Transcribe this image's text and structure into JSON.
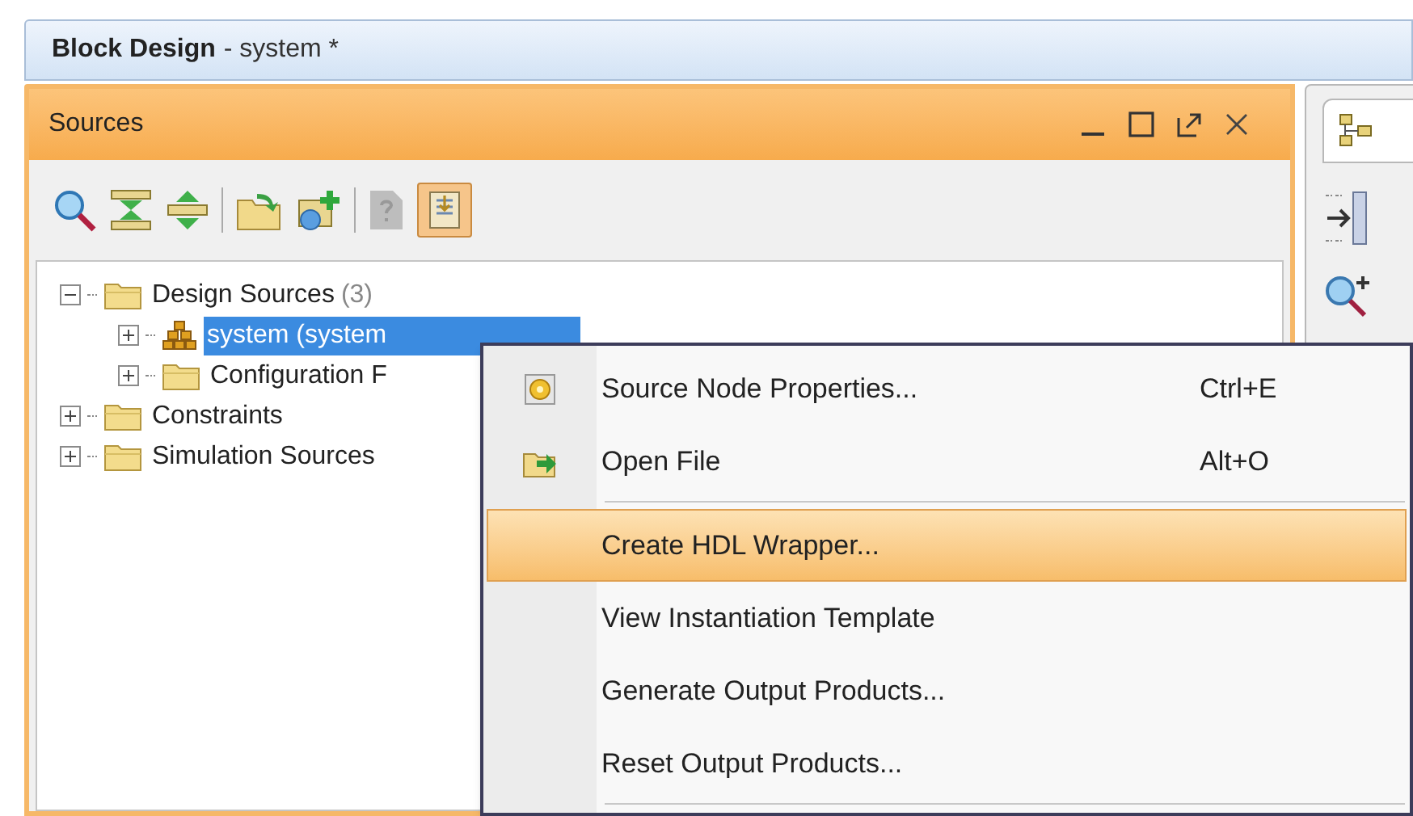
{
  "window": {
    "title": "Block Design",
    "subtitle": "- system *"
  },
  "sources_panel": {
    "title": "Sources",
    "active": true
  },
  "toolbar": {
    "toggle_pressed": true
  },
  "tree": [
    {
      "label": "Design Sources",
      "count": "(3)",
      "kind": "folder",
      "expanded": true,
      "selected": false,
      "children": [
        {
          "label": "system (system",
          "kind": "block",
          "expanded": false,
          "selected": true
        },
        {
          "label": "Configuration F",
          "kind": "folder",
          "expanded": false,
          "selected": false
        }
      ]
    },
    {
      "label": "Constraints",
      "kind": "folder",
      "expanded": false,
      "selected": false
    },
    {
      "label": "Simulation Sources",
      "kind": "folder",
      "expanded": false,
      "selected": false
    }
  ],
  "context_menu": [
    {
      "label": "Source Node Properties...",
      "shortcut": "Ctrl+E",
      "kind": "properties",
      "selected": false,
      "separator_after": false
    },
    {
      "label": "Open File",
      "shortcut": "Alt+O",
      "kind": "open",
      "selected": false,
      "separator_after": true
    },
    {
      "label": "Create HDL Wrapper...",
      "kind": "plain",
      "selected": true,
      "separator_after": false
    },
    {
      "label": "View Instantiation Template",
      "kind": "plain",
      "selected": false,
      "separator_after": false
    },
    {
      "label": "Generate Output Products...",
      "kind": "plain",
      "selected": false,
      "separator_after": false
    },
    {
      "label": "Reset Output Products...",
      "kind": "plain",
      "selected": false,
      "separator_after": true
    }
  ]
}
